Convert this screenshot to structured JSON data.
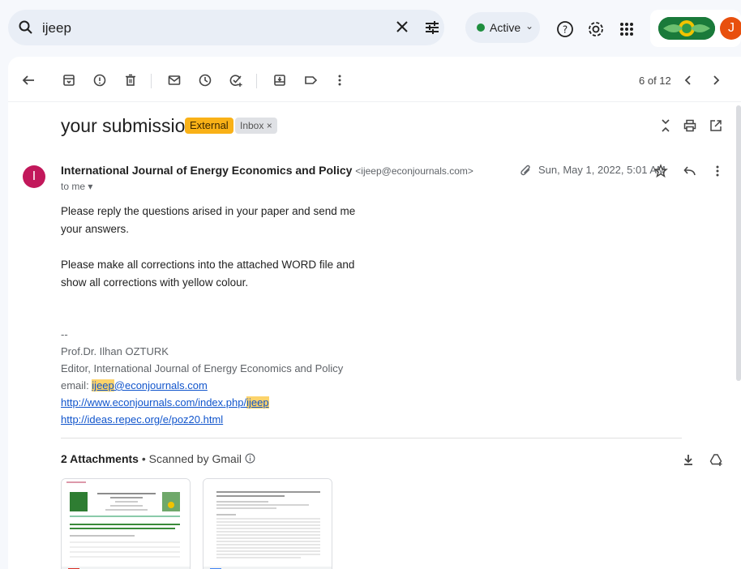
{
  "search": {
    "query": "ijeep"
  },
  "status": {
    "label": "Active"
  },
  "account": {
    "initial": "J"
  },
  "pager": {
    "text": "6 of 12"
  },
  "email": {
    "subject": "your submission",
    "labels": [
      "External",
      "Inbox ×"
    ],
    "sender_name": "International Journal of Energy Economics and Policy",
    "sender_email": "<ijeep@econjournals.com>",
    "sender_initial": "I",
    "recipient": "to me ▾",
    "date": "Sun, May 1, 2022, 5:01 AM",
    "body": [
      "Please reply the questions arised in your paper and send me your answers.",
      "Please make all corrections into the attached WORD file and show all corrections with yellow colour."
    ],
    "signature": {
      "dashes": "--",
      "name": "Prof.Dr. Ilhan OZTURK",
      "title": "Editor, International Journal of Energy Economics and Policy",
      "email_prefix": "email: ",
      "email_highlight": "ijeep",
      "email_rest": "@econjournals.com",
      "link1_main": "http://www.econjournals.com/index.php/",
      "link1_highlight": "ijeep",
      "link2": "http://ideas.repec.org/e/poz20.html"
    }
  },
  "attachments": {
    "count_label": "2 Attachments",
    "scanned_label": "Scanned by Gmail"
  },
  "colors": {
    "external_badge": "#f9b117",
    "highlight": "#fcd36b",
    "link": "#1155cc",
    "sender_avatar": "#c2185b",
    "user_avatar": "#e8500e"
  }
}
